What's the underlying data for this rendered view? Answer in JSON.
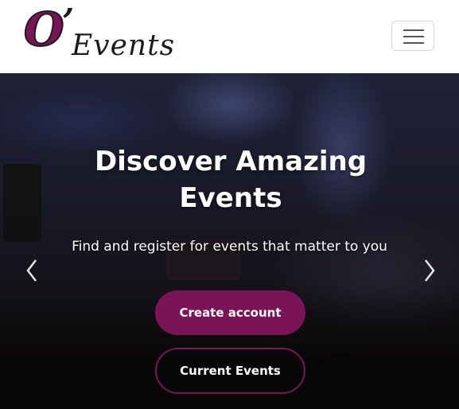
{
  "brand": {
    "logo_o": "O",
    "logo_apostrophe": "’",
    "logo_events": "Events",
    "accent_color": "#7a1457"
  },
  "nav": {
    "toggler_icon": "hamburger-icon"
  },
  "hero": {
    "title": "Discover Amazing Events",
    "subtitle": "Find and register for events that matter to you",
    "primary_button": "Create account",
    "secondary_button": "Current Events",
    "prev_icon": "chevron-left-icon",
    "next_icon": "chevron-right-icon"
  }
}
